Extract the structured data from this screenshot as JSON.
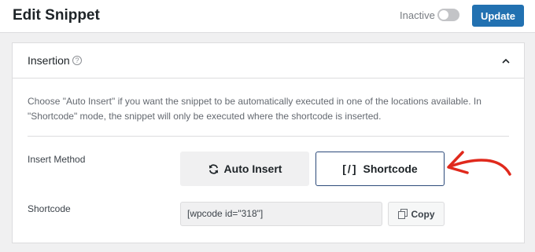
{
  "header": {
    "title": "Edit Snippet",
    "status_label": "Inactive",
    "toggle_state": "off",
    "update_label": "Update"
  },
  "panel": {
    "title": "Insertion",
    "help_icon": "question-circle-icon",
    "collapse_icon": "chevron-up-icon",
    "description_line1": "Choose \"Auto Insert\" if you want the snippet to be automatically executed in one of the locations available. In",
    "description_line2": "\"Shortcode\" mode, the snippet will only be executed where the shortcode is inserted.",
    "insert_method_label": "Insert Method",
    "auto_insert_label": "Auto Insert",
    "auto_insert_icon": "sync-icon",
    "shortcode_method_label": "Shortcode",
    "shortcode_method_prefix": "[/]",
    "selected_method": "Shortcode",
    "shortcode_label": "Shortcode",
    "shortcode_value": "[wpcode id=\"318\"]",
    "copy_label": "Copy",
    "copy_icon": "copy-icon"
  },
  "colors": {
    "accent": "#2271b1",
    "selected_border": "#2c4a7a",
    "annotation_arrow": "#e0291c"
  }
}
